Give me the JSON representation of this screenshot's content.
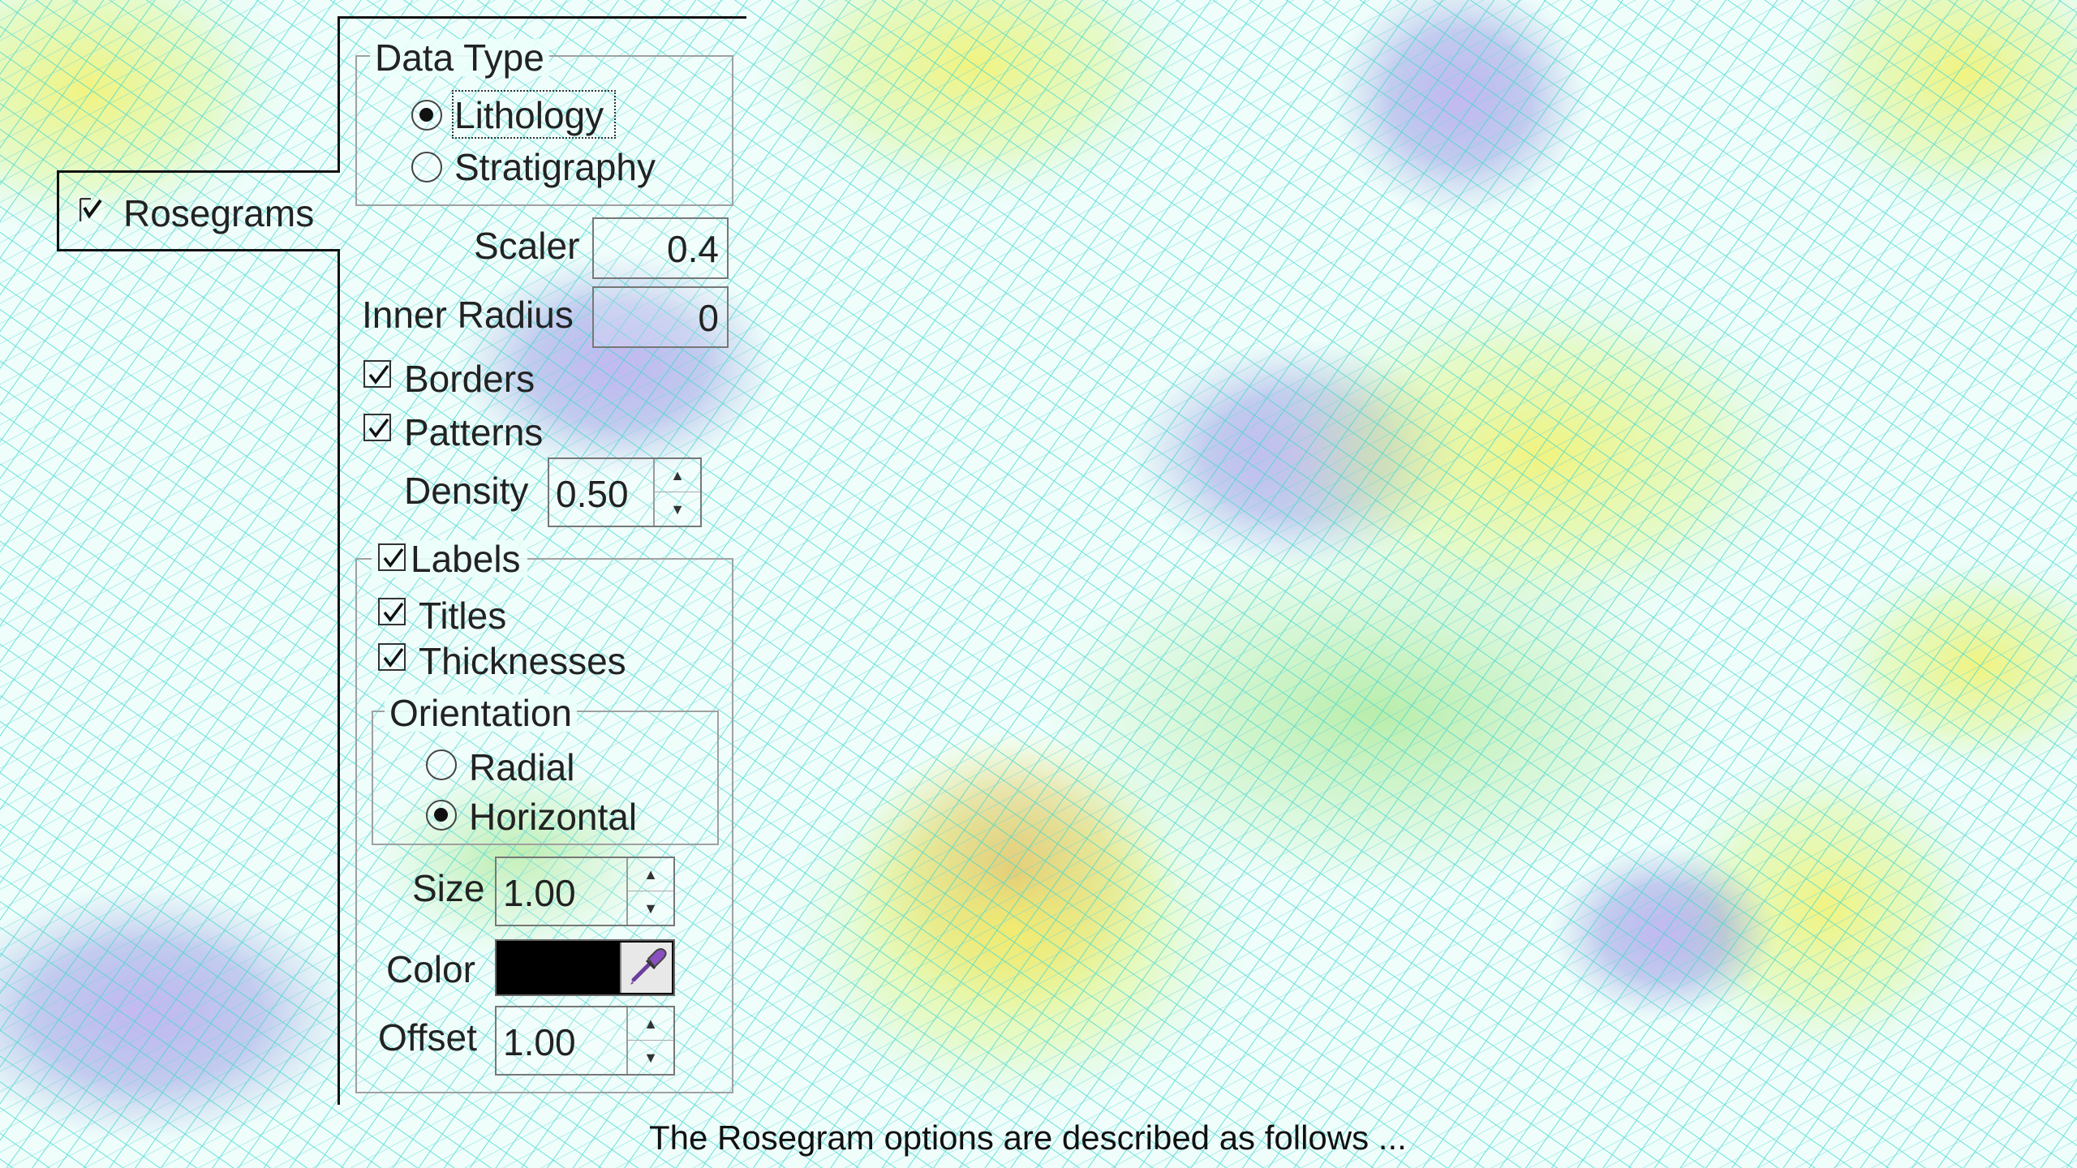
{
  "callout": {
    "rosegrams_label": "Rosegrams",
    "rosegrams_checked": true
  },
  "data_type": {
    "title": "Data Type",
    "options": [
      {
        "label": "Lithology",
        "selected": true
      },
      {
        "label": "Stratigraphy",
        "selected": false
      }
    ]
  },
  "scaler": {
    "label": "Scaler",
    "value": "0.4"
  },
  "inner_radius": {
    "label": "Inner Radius",
    "value": "0"
  },
  "borders": {
    "label": "Borders",
    "checked": true
  },
  "patterns": {
    "label": "Patterns",
    "checked": true
  },
  "density": {
    "label": "Density",
    "value": "0.50"
  },
  "labels": {
    "title": "Labels",
    "checked": true,
    "titles": {
      "label": "Titles",
      "checked": true
    },
    "thicknesses": {
      "label": "Thicknesses",
      "checked": true
    },
    "orientation": {
      "title": "Orientation",
      "options": [
        {
          "label": "Radial",
          "selected": false
        },
        {
          "label": "Horizontal",
          "selected": true
        }
      ]
    },
    "size": {
      "label": "Size",
      "value": "1.00"
    },
    "color": {
      "label": "Color",
      "value": "#000000"
    },
    "offset": {
      "label": "Offset",
      "value": "1.00"
    }
  },
  "caption": "The Rosegram options are described as follows ...",
  "colors": {
    "mesh_cyan": "#35d6d0",
    "mesh_yellow": "#eef06a",
    "mesh_purple": "#7a6cc4",
    "mesh_red": "#e06a4a"
  },
  "icons": {
    "eyedropper": "eyedropper-icon"
  }
}
